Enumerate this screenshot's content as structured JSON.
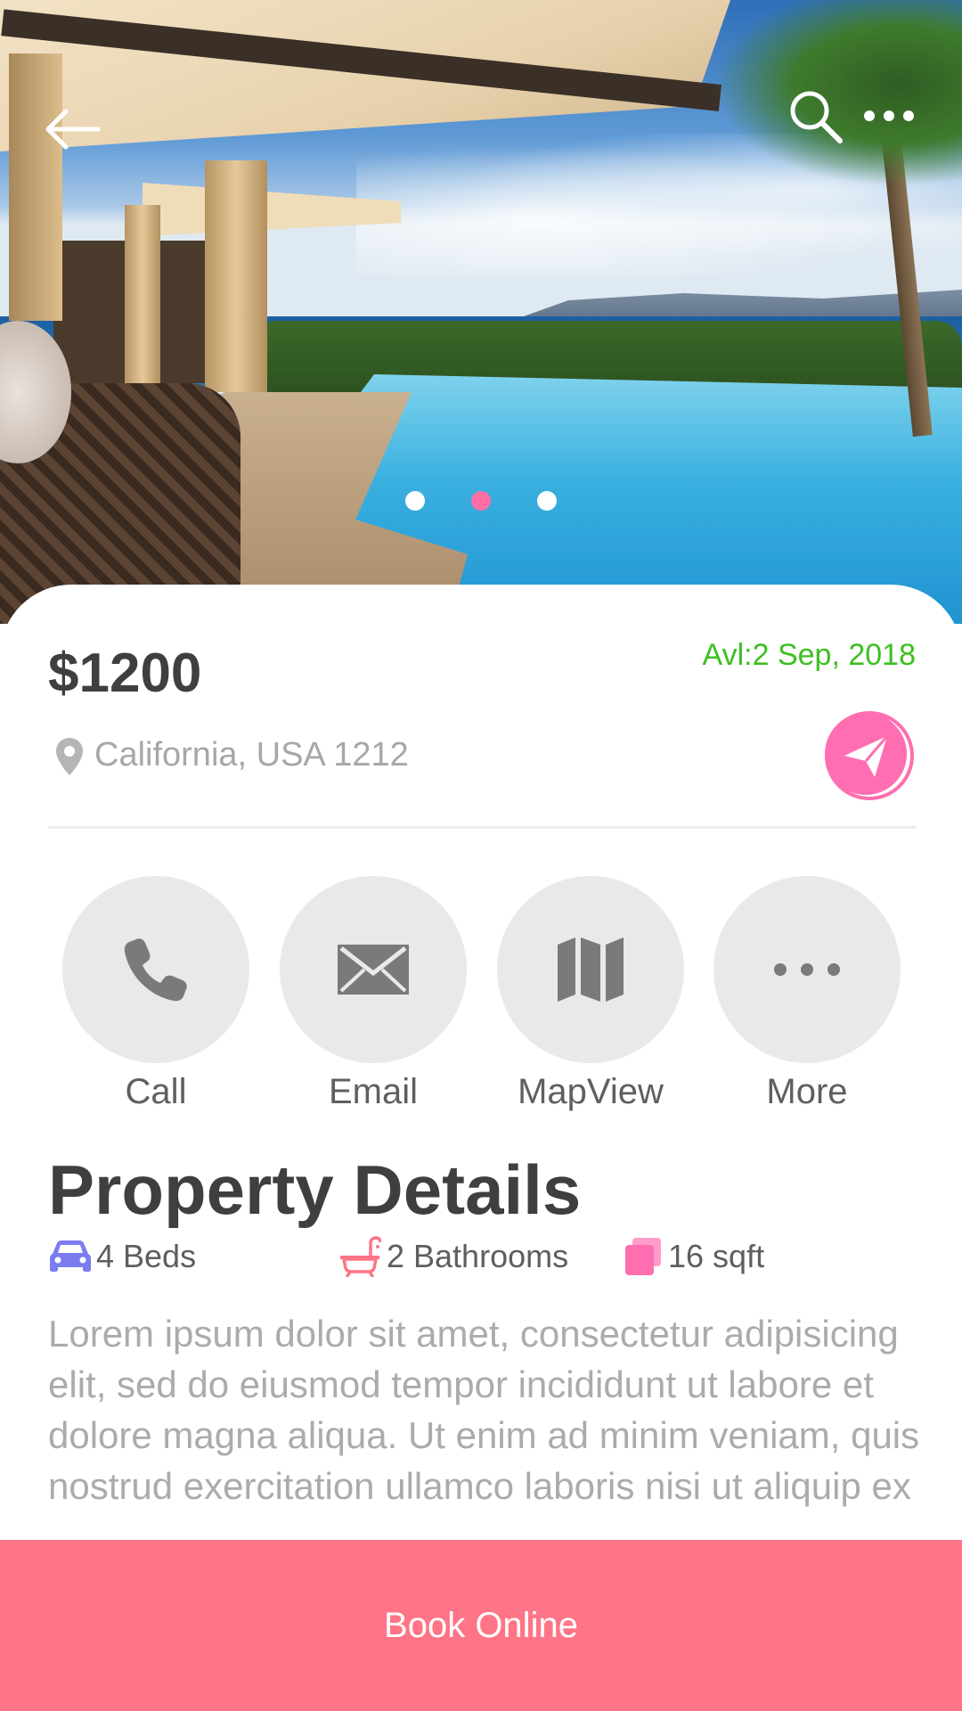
{
  "header": {
    "icons": {
      "back": "back-arrow-icon",
      "search": "search-icon",
      "more": "more-dots-icon"
    }
  },
  "carousel": {
    "slide_count": 3,
    "active_index": 1
  },
  "listing": {
    "price": "$1200",
    "availability": "Avl:2 Sep, 2018",
    "location": "California, USA 1212"
  },
  "actions": [
    {
      "label": "Call",
      "icon": "phone-icon"
    },
    {
      "label": "Email",
      "icon": "envelope-icon"
    },
    {
      "label": "MapView",
      "icon": "map-icon"
    },
    {
      "label": "More",
      "icon": "more-dots-icon"
    }
  ],
  "details": {
    "title": "Property Details",
    "features": [
      {
        "text": "4 Beds",
        "icon": "car-icon",
        "color": "#7b7cf0"
      },
      {
        "text": "2 Bathrooms",
        "icon": "bathtub-icon",
        "color": "#ff7486"
      },
      {
        "text": "16 sqft",
        "icon": "area-icon",
        "color": "#ff6eb0"
      }
    ],
    "description": "Lorem ipsum dolor sit amet, consectetur adipisicing elit, sed do eiusmod tempor incididunt ut labore et dolore magna aliqua. Ut enim ad minim veniam, quis nostrud exercitation ullamco laboris nisi ut aliquip ex"
  },
  "footer": {
    "book_label": "Book Online"
  },
  "colors": {
    "accent": "#ff7486",
    "active_dot": "#ff6ea4",
    "availability": "#3cc020",
    "price": "#3f3f3f"
  }
}
